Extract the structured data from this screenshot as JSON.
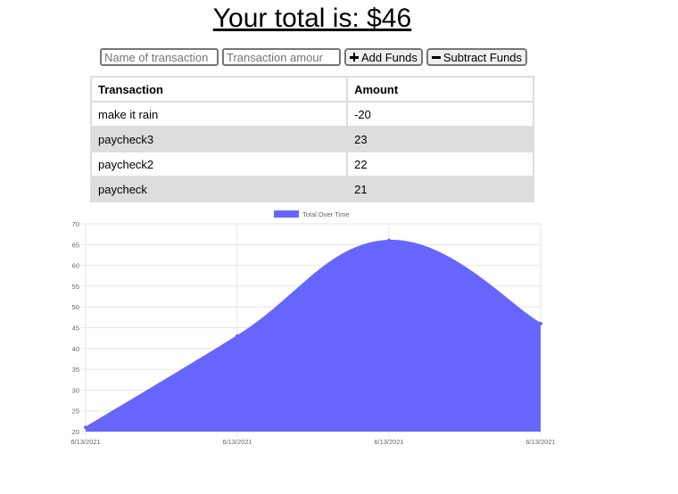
{
  "header": {
    "total_text": "Your total is: $46"
  },
  "form": {
    "name_placeholder": "Name of transaction",
    "amount_placeholder": "Transaction amount",
    "add_label": "Add Funds",
    "subtract_label": "Subtract Funds",
    "add_icon": "plus-icon",
    "subtract_icon": "minus-icon"
  },
  "table": {
    "headers": [
      "Transaction",
      "Amount"
    ],
    "rows": [
      {
        "name": "make it rain",
        "amount": "-20"
      },
      {
        "name": "paycheck3",
        "amount": "23"
      },
      {
        "name": "paycheck2",
        "amount": "22"
      },
      {
        "name": "paycheck",
        "amount": "21"
      }
    ]
  },
  "chart_data": {
    "type": "area",
    "legend": "Total Over Time",
    "legend_position": "top",
    "x": [
      "6/13/2021",
      "6/13/2021",
      "6/13/2021",
      "6/13/2021"
    ],
    "series": [
      {
        "name": "Total Over Time",
        "values": [
          21,
          43,
          66,
          46
        ]
      }
    ],
    "ylim": [
      20,
      70
    ],
    "yticks": [
      20,
      25,
      30,
      35,
      40,
      45,
      50,
      55,
      60,
      65,
      70
    ],
    "grid": true,
    "color": "#6666ff"
  }
}
